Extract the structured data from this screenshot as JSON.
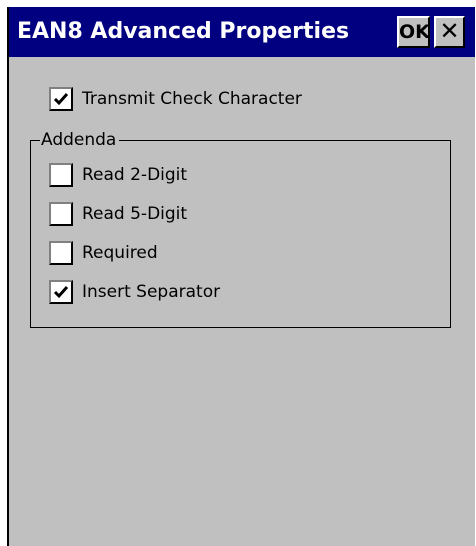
{
  "window": {
    "title": "EAN8 Advanced Properties",
    "ok_label": "OK",
    "close_label": "✕"
  },
  "options": {
    "transmit_check": {
      "label": "Transmit Check Character",
      "checked": true
    }
  },
  "addenda": {
    "legend": "Addenda",
    "items": [
      {
        "label": "Read 2-Digit",
        "checked": false
      },
      {
        "label": "Read 5-Digit",
        "checked": false
      },
      {
        "label": "Required",
        "checked": false
      },
      {
        "label": "Insert Separator",
        "checked": true
      }
    ]
  },
  "colors": {
    "titlebar": "#000080",
    "face": "#c0c0c0"
  }
}
